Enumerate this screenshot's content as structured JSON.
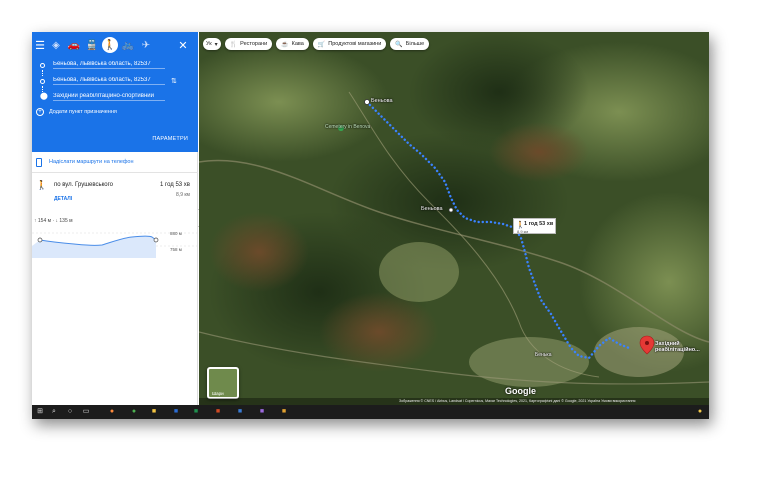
{
  "header": {
    "modes": [
      "menu-icon",
      "best-route-icon",
      "car-icon",
      "transit-icon",
      "walking-icon",
      "bicycle-icon",
      "flight-icon"
    ],
    "waypoints": [
      "Беньова, Львівська область, 82537",
      "Беньова, Львівська область, 82537",
      "Західний реабілітаційно-спортивний"
    ],
    "add_destination": "Додати пункт призначення",
    "options_label": "ПАРАМЕТРИ"
  },
  "send_to_phone": "Надіслати маршрути на телефон",
  "route": {
    "via": "по вул. Грушевського",
    "duration": "1 год 53 хв",
    "distance": "8,9 км",
    "details": "ДЕТАЛІ"
  },
  "elevation": {
    "summary": "↑ 154 м · ↓ 135 м",
    "max_label": "880 м",
    "min_label": "758 м"
  },
  "map": {
    "chips": [
      {
        "icon": "language-icon",
        "label": "Ук"
      },
      {
        "icon": "fork-knife-icon",
        "label": "Ресторани"
      },
      {
        "icon": "coffee-icon",
        "label": "Кава"
      },
      {
        "icon": "cart-icon",
        "label": "Продуктові магазини"
      },
      {
        "icon": "search-icon",
        "label": "Більше"
      }
    ],
    "labels": {
      "start": "Беньова",
      "village": "Беньова",
      "cemetery": "Cemetery in Benova",
      "town": "Бенька",
      "destination": "Західний реабілітаційно..."
    },
    "duration_box": {
      "time": "1 год 53 хв",
      "distance": "8,9 км"
    },
    "layer_label": "Шари",
    "logo": "Google",
    "attribution": "Зображення © CNES / Airbus, Landsat / Copernicus, Maxar Technologies, 2021, Картографічні дані © Google, 2021   Україна   Умови використання"
  }
}
